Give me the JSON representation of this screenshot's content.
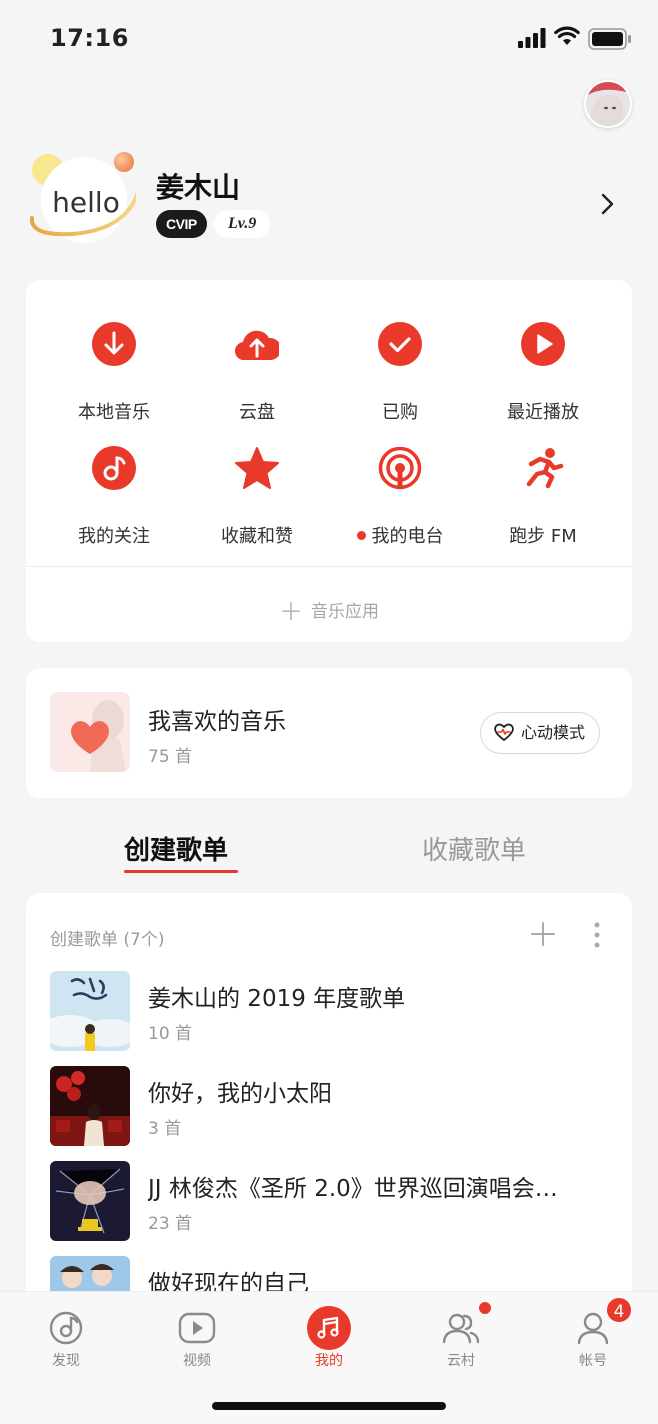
{
  "status_bar": {
    "time": "17:16"
  },
  "profile": {
    "avatar_text": "hello",
    "name": "姜木山",
    "vip_label": "CVIP",
    "level_label": "Lv.9"
  },
  "grid": {
    "items": [
      {
        "label": "本地音乐",
        "icon": "download-icon"
      },
      {
        "label": "云盘",
        "icon": "cloud-upload-icon"
      },
      {
        "label": "已购",
        "icon": "check-icon"
      },
      {
        "label": "最近播放",
        "icon": "play-icon"
      },
      {
        "label": "我的关注",
        "icon": "music-note-icon"
      },
      {
        "label": "收藏和赞",
        "icon": "star-icon"
      },
      {
        "label": "我的电台",
        "icon": "radio-icon",
        "dot": true
      },
      {
        "label": "跑步 FM",
        "icon": "running-icon"
      }
    ],
    "music_app_label": "音乐应用"
  },
  "liked": {
    "title": "我喜欢的音乐",
    "count": "75 首",
    "heart_mode_label": "心动模式"
  },
  "tabs": {
    "created": "创建歌单",
    "collected": "收藏歌单"
  },
  "playlists": {
    "header": "创建歌单 (7个)",
    "items": [
      {
        "name": "姜木山的 2019 年度歌单",
        "count": "10 首"
      },
      {
        "name": "你好，我的小太阳",
        "count": "3 首"
      },
      {
        "name": "JJ 林俊杰《圣所 2.0》世界巡回演唱会…",
        "count": "23 首"
      },
      {
        "name": "做好现在的自己",
        "count": ""
      }
    ]
  },
  "bottom_nav": {
    "items": [
      {
        "label": "发现",
        "icon": "discover-icon"
      },
      {
        "label": "视频",
        "icon": "video-icon"
      },
      {
        "label": "我的",
        "icon": "my-music-icon",
        "active": true
      },
      {
        "label": "云村",
        "icon": "community-icon",
        "dot": true
      },
      {
        "label": "帐号",
        "icon": "account-icon",
        "badge": "4"
      }
    ]
  },
  "colors": {
    "accent": "#e8392b",
    "background": "#f5f5f6",
    "card": "#ffffff"
  }
}
